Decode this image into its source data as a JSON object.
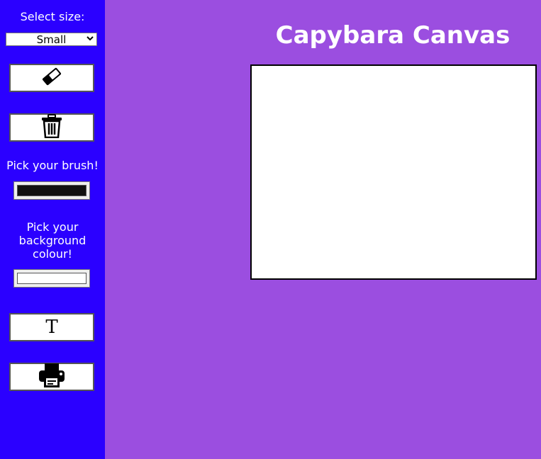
{
  "sidebar": {
    "size_label": "Select size:",
    "size_selected": "Small",
    "brush_label": "Pick your brush!",
    "brush_color": "#111111",
    "background_label": "Pick your background colour!",
    "background_color": "#ffffff",
    "tools": {
      "eraser_icon": "eraser-icon",
      "trash_icon": "trash-icon",
      "text_glyph": "T",
      "print_icon": "printer-icon"
    }
  },
  "main": {
    "title": "Capybara Canvas"
  },
  "colors": {
    "sidebar_bg": "#2b00ff",
    "page_bg": "#9b4ee0",
    "canvas_bg": "#ffffff"
  }
}
